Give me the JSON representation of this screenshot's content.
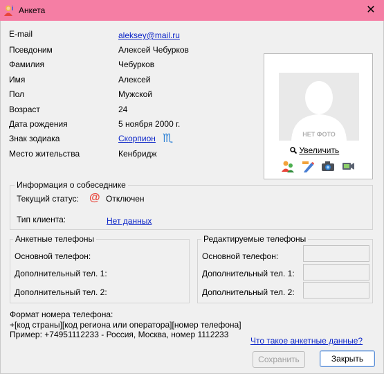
{
  "window": {
    "title": "Анкета"
  },
  "profile": {
    "email_label": "E-mail",
    "email_value": "aleksey@mail.ru",
    "nickname_label": "Псевдоним",
    "nickname_value": "Алексей Чебурков",
    "surname_label": "Фамилия",
    "surname_value": "Чебурков",
    "name_label": "Имя",
    "name_value": "Алексей",
    "gender_label": "Пол",
    "gender_value": "Мужской",
    "age_label": "Возраст",
    "age_value": "24",
    "birthdate_label": "Дата рождения",
    "birthdate_value": "5 ноября 2000 г.",
    "zodiac_label": "Знак зодиака",
    "zodiac_value": "Скорпион",
    "zodiac_symbol": "♏",
    "city_label": "Место жительства",
    "city_value": "Кенбридж"
  },
  "photo": {
    "placeholder_text": "НЕТ ФОТО",
    "zoom_label": "Увеличить",
    "icons": [
      "users-icon",
      "edit-icon",
      "camera-icon",
      "webcam-icon"
    ]
  },
  "contact_info": {
    "title": "Информация о собеседнике",
    "status_label": "Текущий статус:",
    "status_value": "Отключен",
    "client_label": "Тип клиента:",
    "client_value": "Нет данных"
  },
  "profile_phones": {
    "title": "Анкетные телефоны",
    "main_label": "Основной телефон:",
    "extra1_label": "Дополнительный тел. 1:",
    "extra2_label": "Дополнительный тел. 2:"
  },
  "editable_phones": {
    "title": "Редактируемые телефоны",
    "main_label": "Основной телефон:",
    "extra1_label": "Дополнительный тел. 1:",
    "extra2_label": "Дополнительный тел. 2:",
    "main_value": "",
    "extra1_value": "",
    "extra2_value": ""
  },
  "format": {
    "heading": "Формат номера телефона:",
    "pattern": "+[код страны][код региона или оператора][номер телефона]",
    "example": "Пример: +74951112233 - Россия, Москва, номер 1112233"
  },
  "footer": {
    "help_link": "Что такое анкетные данные?",
    "save_label": "Сохранить",
    "close_label": "Закрыть"
  },
  "colors": {
    "titlebar": "#f57ea4",
    "link": "#0a24c8",
    "status_icon": "#e8443a",
    "zodiac_symbol": "#2b7fd4"
  }
}
